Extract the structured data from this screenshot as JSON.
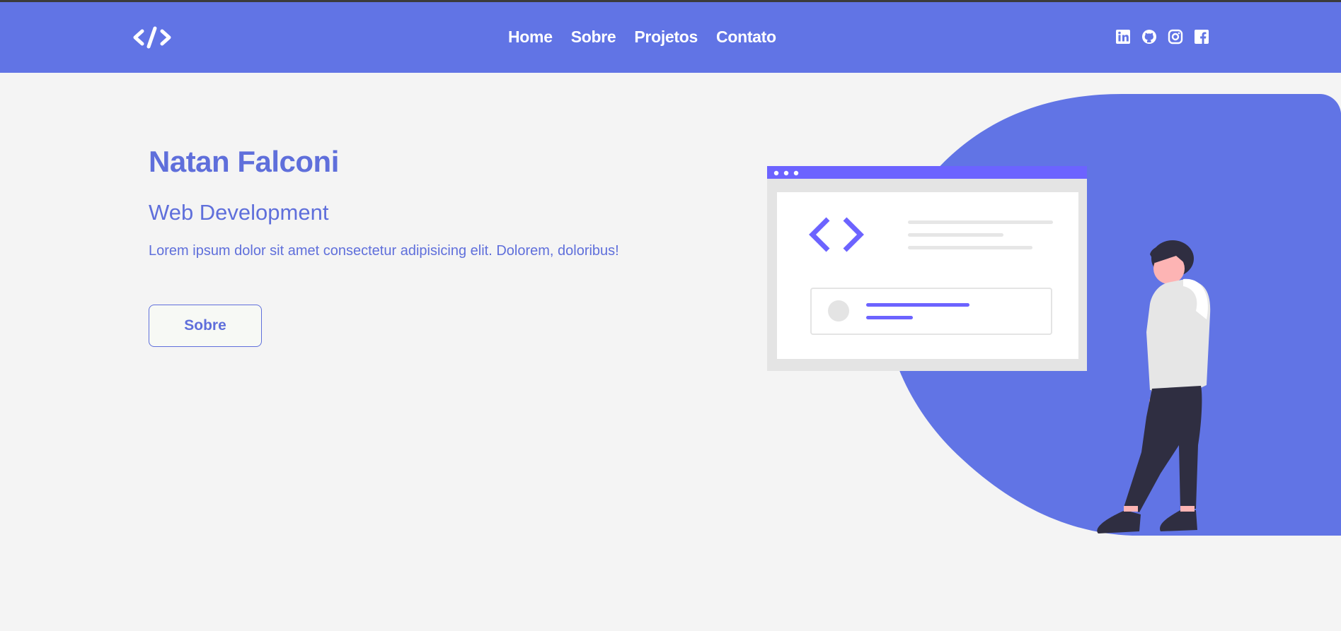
{
  "header": {
    "logo_icon": "code-brackets-icon",
    "nav": [
      {
        "label": "Home"
      },
      {
        "label": "Sobre"
      },
      {
        "label": "Projetos"
      },
      {
        "label": "Contato"
      }
    ],
    "social_icons": [
      "linkedin-icon",
      "github-icon",
      "instagram-icon",
      "facebook-icon"
    ]
  },
  "hero": {
    "title": "Natan Falconi",
    "subtitle": "Web Development",
    "description": "Lorem ipsum dolor sit amet consectetur adipisicing elit. Dolorem, doloribus!",
    "button_label": "Sobre"
  },
  "colors": {
    "primary": "#6174e5",
    "accent": "#6c63ff",
    "background": "#f4f4f4",
    "text": "#5f6fdb"
  }
}
